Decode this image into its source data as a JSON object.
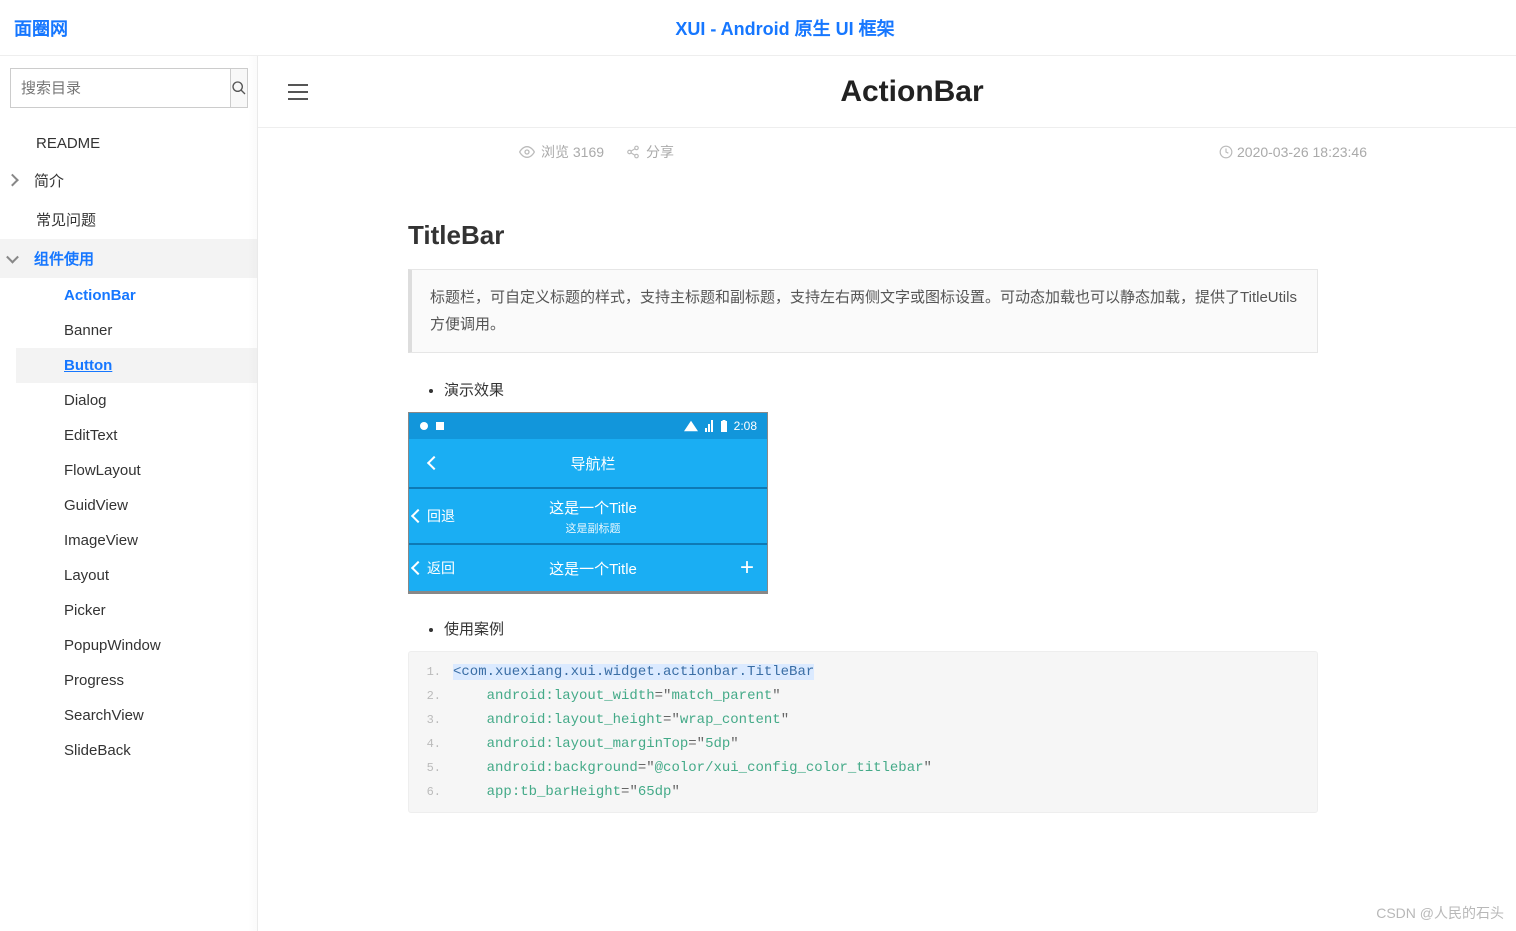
{
  "top": {
    "brand": "面圈网",
    "title": "XUI - Android 原生 UI 框架"
  },
  "search": {
    "placeholder": "搜索目录"
  },
  "nav": {
    "items": [
      {
        "label": "README",
        "type": "item"
      },
      {
        "label": "简介",
        "type": "group",
        "expandable": true
      },
      {
        "label": "常见问题",
        "type": "item"
      },
      {
        "label": "组件使用",
        "type": "group",
        "expandable": true,
        "expanded": true,
        "current": true
      }
    ],
    "sub": [
      {
        "label": "ActionBar",
        "active": true
      },
      {
        "label": "Banner"
      },
      {
        "label": "Button",
        "hover": true
      },
      {
        "label": "Dialog"
      },
      {
        "label": "EditText"
      },
      {
        "label": "FlowLayout"
      },
      {
        "label": "GuidView"
      },
      {
        "label": "ImageView"
      },
      {
        "label": "Layout"
      },
      {
        "label": "Picker"
      },
      {
        "label": "PopupWindow"
      },
      {
        "label": "Progress"
      },
      {
        "label": "SearchView"
      },
      {
        "label": "SlideBack"
      }
    ]
  },
  "page": {
    "title": "ActionBar",
    "views_label": "浏览 3169",
    "share_label": "分享",
    "date": "2020-03-26 18:23:46"
  },
  "article": {
    "h2": "TitleBar",
    "quote": "标题栏，可自定义标题的样式，支持主标题和副标题，支持左右两侧文字或图标设置。可动态加载也可以静态加载，提供了TitleUtils方便调用。",
    "demo_label": "演示效果",
    "usage_label": "使用案例"
  },
  "phone": {
    "time": "2:08",
    "row1_title": "导航栏",
    "row2_back": "回退",
    "row2_title": "这是一个Title",
    "row2_sub": "这是副标题",
    "row3_back": "返回",
    "row3_title": "这是一个Title"
  },
  "code": {
    "lines": [
      {
        "n": "1.",
        "kind": "tag-open",
        "text": "<com.xuexiang.xui.widget.actionbar.TitleBar",
        "hl": true
      },
      {
        "n": "2.",
        "kind": "attr",
        "attr": "android:layout_width",
        "val": "match_parent"
      },
      {
        "n": "3.",
        "kind": "attr",
        "attr": "android:layout_height",
        "val": "wrap_content"
      },
      {
        "n": "4.",
        "kind": "attr",
        "attr": "android:layout_marginTop",
        "val": "5dp"
      },
      {
        "n": "5.",
        "kind": "attr",
        "attr": "android:background",
        "val": "@color/xui_config_color_titlebar"
      },
      {
        "n": "6.",
        "kind": "attr",
        "attr": "app:tb_barHeight",
        "val": "65dp"
      }
    ]
  },
  "watermark": "CSDN @人民的石头"
}
